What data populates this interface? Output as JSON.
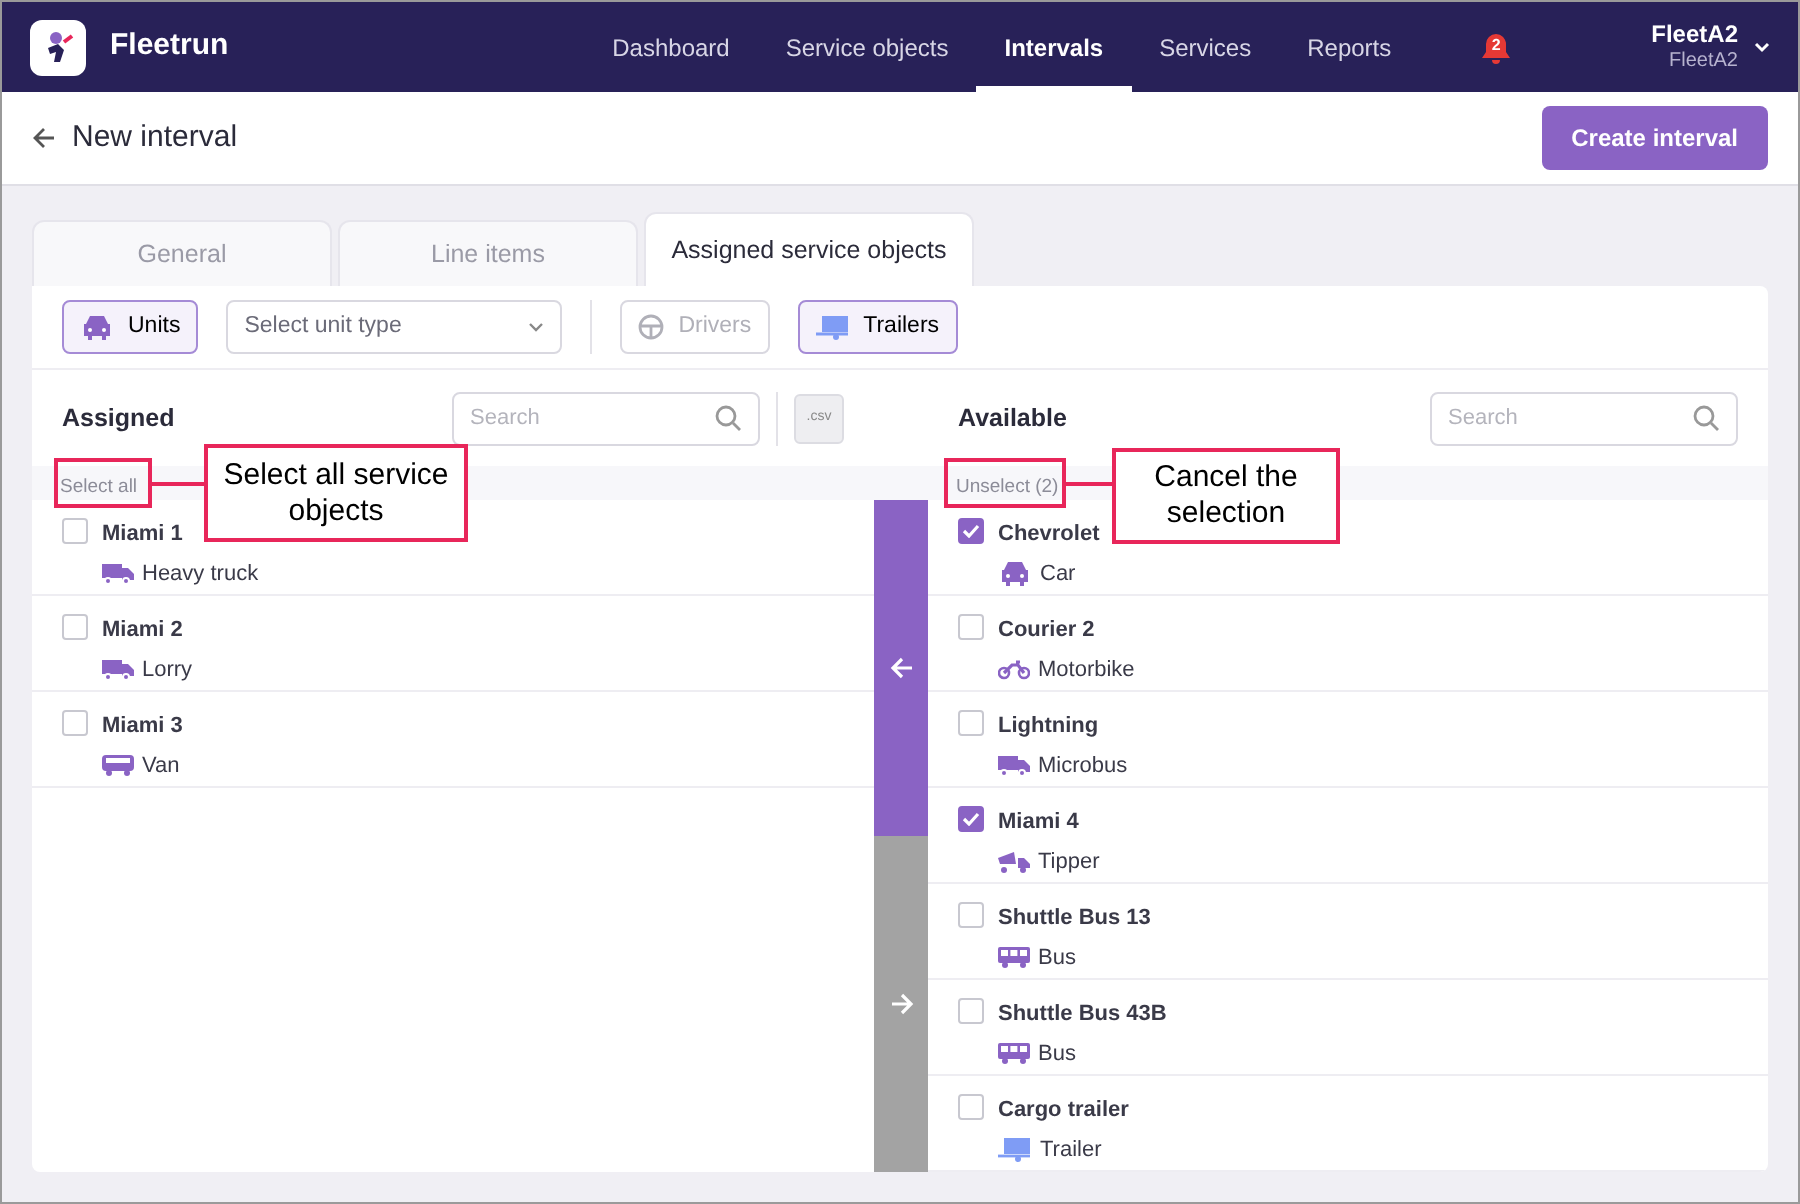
{
  "navbar": {
    "brand": "Fleetrun",
    "items": [
      {
        "label": "Dashboard",
        "selected": false
      },
      {
        "label": "Service objects",
        "selected": false
      },
      {
        "label": "Intervals",
        "selected": true
      },
      {
        "label": "Services",
        "selected": false
      },
      {
        "label": "Reports",
        "selected": false
      }
    ],
    "notifications": "2",
    "user": {
      "name": "FleetA2",
      "account": "FleetA2"
    }
  },
  "header": {
    "title": "New interval",
    "action": "Create interval"
  },
  "tabs": [
    {
      "label": "General",
      "selected": false
    },
    {
      "label": "Line items",
      "selected": false
    },
    {
      "label": "Assigned service objects",
      "selected": true
    }
  ],
  "filters": [
    {
      "kind": "button",
      "label": "Units",
      "selected": true,
      "disabled": false
    },
    {
      "kind": "select",
      "placeholder": "Select unit type"
    },
    {
      "kind": "button",
      "label": "Drivers",
      "selected": false,
      "disabled": true
    },
    {
      "kind": "button",
      "label": "Trailers",
      "selected": true,
      "disabled": false
    }
  ],
  "assigned": {
    "title": "Assigned",
    "search_placeholder": "Search",
    "export": ".csv",
    "select_action": "Select all",
    "items": [
      {
        "name": "Miami 1",
        "type": "Heavy truck",
        "kind": "truck",
        "checked": false
      },
      {
        "name": "Miami 2",
        "type": "Lorry",
        "kind": "truck",
        "checked": false
      },
      {
        "name": "Miami 3",
        "type": "Van",
        "kind": "van",
        "checked": false
      }
    ]
  },
  "available": {
    "title": "Available",
    "search_placeholder": "Search",
    "select_action": "Unselect (2)",
    "items": [
      {
        "name": "Chevrolet",
        "type": "Car",
        "kind": "car",
        "checked": true
      },
      {
        "name": "Courier 2",
        "type": "Motorbike",
        "kind": "motorbike",
        "checked": false
      },
      {
        "name": "Lightning",
        "type": "Microbus",
        "kind": "truck",
        "checked": false
      },
      {
        "name": "Miami 4",
        "type": "Tipper",
        "kind": "tipper",
        "checked": true
      },
      {
        "name": "Shuttle Bus 13",
        "type": "Bus",
        "kind": "bus",
        "checked": false
      },
      {
        "name": "Shuttle Bus 43B",
        "type": "Bus",
        "kind": "bus",
        "checked": false
      },
      {
        "name": "Cargo trailer",
        "type": "Trailer",
        "kind": "trailer",
        "checked": false
      }
    ]
  },
  "callouts": [
    {
      "text": "Select all service objects"
    },
    {
      "text": "Cancel the selection"
    }
  ]
}
